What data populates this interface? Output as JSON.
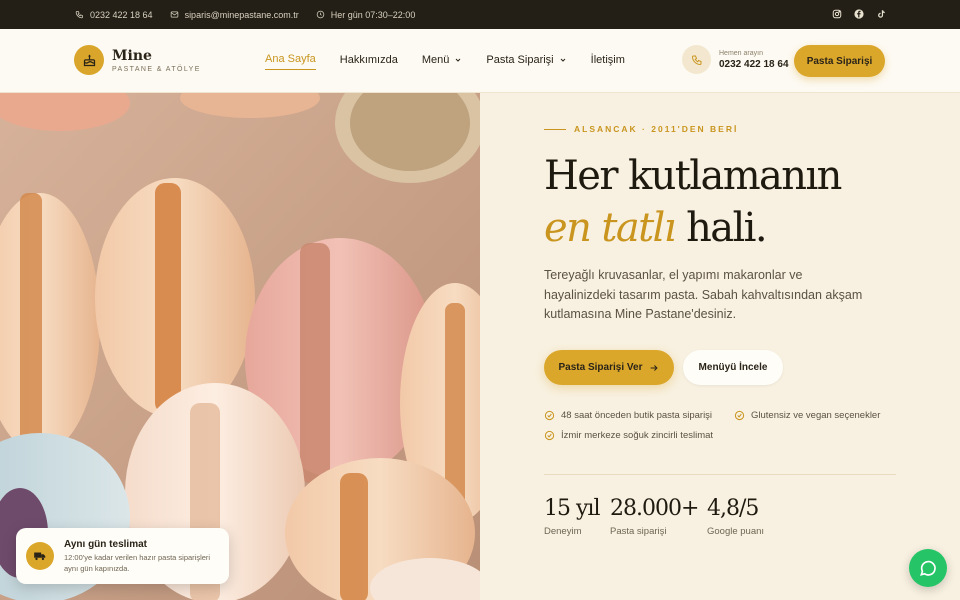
{
  "topbar": {
    "phone": "0232 422 18 64",
    "email": "siparis@minepastane.com.tr",
    "hours": "Her gün 07:30–22:00",
    "social_icons": [
      "instagram-icon",
      "facebook-icon",
      "tiktok-icon"
    ]
  },
  "brand": {
    "name": "Mine",
    "subtitle": "PASTANE & ATÖLYE",
    "accent_color": "#dba72b"
  },
  "nav": {
    "items": [
      {
        "label": "Ana Sayfa",
        "active": true
      },
      {
        "label": "Hakkımızda"
      },
      {
        "label": "Menü",
        "dropdown": true
      },
      {
        "label": "Pasta Siparişi",
        "dropdown": true
      },
      {
        "label": "İletişim"
      }
    ]
  },
  "header_phone": {
    "caption": "Hemen arayın",
    "number": "0232 422 18 64"
  },
  "header_cta": "Pasta Siparişi",
  "hero": {
    "eyebrow": "ALSANCAK · 2011'DEN BERİ",
    "headline_line1": "Her kutlamanın",
    "headline_accent": "en tatlı",
    "headline_rest": "hali.",
    "lead": "Tereyağlı kruvasanlar, el yapımı makaronlar ve hayalinizdeki tasarım pasta. Sabah kahvaltısından akşam kutlamasına Mine Pastane'desiniz.",
    "primary_cta": "Pasta Siparişi Ver",
    "secondary_cta": "Menüyü İncele",
    "features": [
      "48 saat önceden butik pasta siparişi",
      "Glutensiz ve vegan seçenekler",
      "İzmir merkeze soğuk zincirli teslimat"
    ],
    "stats": [
      {
        "value": "15 yıl",
        "label": "Deneyim"
      },
      {
        "value": "28.000+",
        "label": "Pasta siparişi"
      },
      {
        "value": "4,8/5",
        "label": "Google puanı"
      }
    ]
  },
  "delivery_card": {
    "title": "Aynı gün teslimat",
    "description": "12:00'ye kadar verilen hazır pasta siparişleri aynı gün kapınızda."
  },
  "whatsapp": {
    "icon": "whatsapp-icon",
    "color": "#25c466"
  }
}
